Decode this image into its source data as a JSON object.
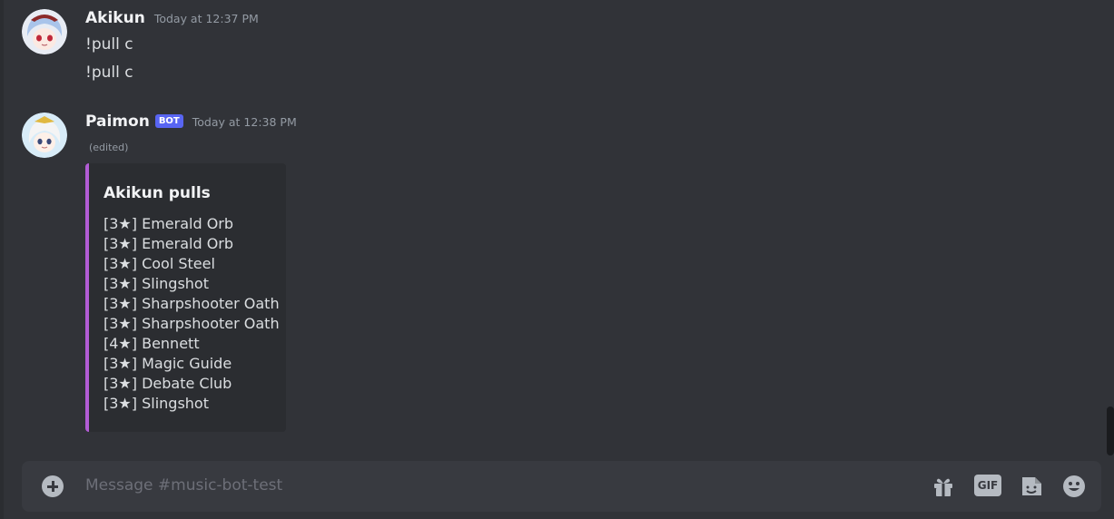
{
  "channel": {
    "placeholder": "Message #music-bot-test"
  },
  "messages": [
    {
      "author": "Akikun",
      "timestamp": "Today at 12:37 PM",
      "lines": [
        "!pull c",
        "!pull c"
      ]
    },
    {
      "author": "Paimon",
      "badge": "BOT",
      "timestamp": "Today at 12:38 PM",
      "edited": "(edited)",
      "embed": {
        "accent_color": "#b25cd5",
        "title": "Akikun pulls",
        "items": [
          "[3★] Emerald Orb",
          "[3★] Emerald Orb",
          "[3★] Cool Steel",
          "[3★] Slingshot",
          "[3★] Sharpshooter Oath",
          "[3★] Sharpshooter Oath",
          "[4★] Bennett",
          "[3★] Magic Guide",
          "[3★] Debate Club",
          "[3★] Slingshot"
        ]
      }
    }
  ],
  "toolbar": {
    "gif_label": "GIF",
    "icons": [
      "gift-icon",
      "gif-icon",
      "sticker-icon",
      "emoji-icon"
    ]
  }
}
